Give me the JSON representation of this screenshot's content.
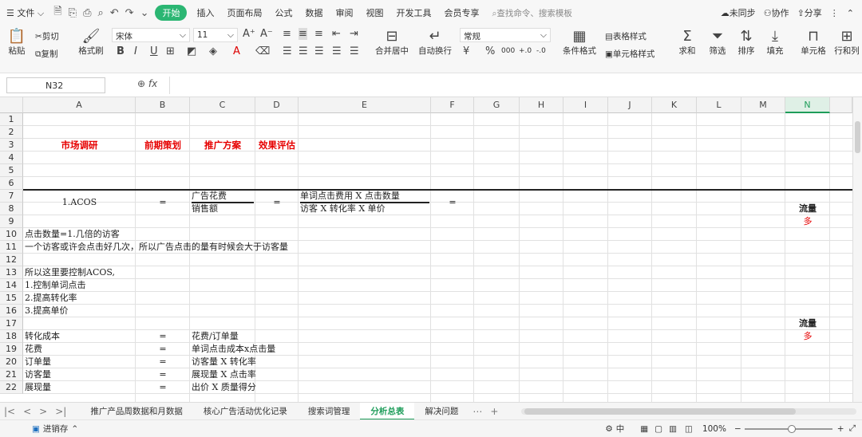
{
  "menu": {
    "file": "文件",
    "start": "开始",
    "items": [
      "插入",
      "页面布局",
      "公式",
      "数据",
      "审阅",
      "视图",
      "开发工具",
      "会员专享"
    ],
    "search_placeholder": "查找命令、搜索模板",
    "unsync": "未同步",
    "collab": "协作",
    "share": "分享"
  },
  "ribbon": {
    "paste": "粘贴",
    "cut": "剪切",
    "copy": "复制",
    "format_painter": "格式刷",
    "font_name": "宋体",
    "font_size": "11",
    "number_format": "常规",
    "merge": "合并居中",
    "wrap": "自动换行",
    "cond_format": "条件格式",
    "table_style": "表格样式",
    "cell_style": "单元格样式",
    "sum": "求和",
    "filter": "筛选",
    "sort": "排序",
    "fill": "填充",
    "cell": "单元格",
    "rowcol": "行和列",
    "font_grow": "A⁺",
    "font_shrink": "A⁻",
    "bold": "B",
    "italic": "I",
    "underline": "U",
    "percent": "%",
    "thousands": "000"
  },
  "formula_bar": {
    "cell_ref": "N32",
    "fx": "fx",
    "formula": ""
  },
  "columns": [
    "A",
    "B",
    "C",
    "D",
    "E",
    "F",
    "G",
    "H",
    "I",
    "J",
    "K",
    "L",
    "M",
    "N"
  ],
  "selected_column": "N",
  "rows": [
    "1",
    "2",
    "3",
    "4",
    "5",
    "6",
    "7",
    "8",
    "9",
    "10",
    "11",
    "12",
    "13",
    "14",
    "15",
    "16",
    "17",
    "18",
    "19",
    "20",
    "21",
    "22"
  ],
  "cells": {
    "a3": "市场调研",
    "b3": "前期策划",
    "c3": "推广方案",
    "d3": "效果评估",
    "a7": "1.ACOS",
    "b7": "=",
    "c7": "广告花费",
    "c8": "销售额",
    "d7": "=",
    "e7": "单词点击费用 X 点击数量",
    "e8": "访客 X 转化率 X 单价",
    "f7": "=",
    "n8": "流量",
    "n9": "多",
    "a10": "点击数量=1.几倍的访客",
    "a11": "一个访客或许会点击好几次，所以广告点击的量有时候会大于访客量",
    "a13": "所以这里要控制ACOS,",
    "a14": "1.控制单词点击",
    "a15": "2.提高转化率",
    "a16": "3.提高单价",
    "n17": "流量",
    "n18": "多",
    "a18": "转化成本",
    "b18": "=",
    "c18": "花费/订单量",
    "a19": "花费",
    "b19": "=",
    "c19": "单词点击成本x点击量",
    "a20": "订单量",
    "b20": "=",
    "c20": "访客量 X 转化率",
    "a21": "访客量",
    "b21": "=",
    "c21": "展现量 X 点击率",
    "a22": "展现量",
    "b22": "=",
    "c22": "出价 X 质量得分"
  },
  "sheets": [
    "推广产品周数据和月数据",
    "核心广告活动优化记录",
    "搜索词管理",
    "分析总表",
    "解决问题"
  ],
  "active_sheet": "分析总表",
  "status": {
    "left": "进销存",
    "zoom": "100%",
    "ime": "中"
  },
  "colors": {
    "accent": "#1e9d5a",
    "red": "#e60000"
  }
}
